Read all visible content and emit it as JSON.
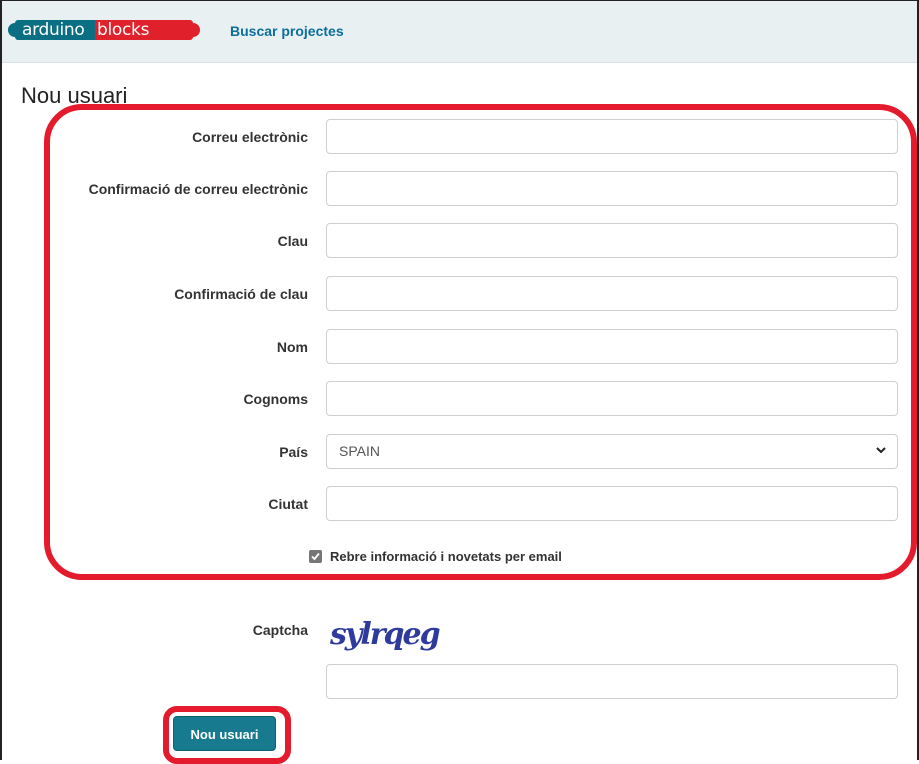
{
  "header": {
    "logo_part1": "arduino",
    "logo_part2": "blocks",
    "nav_link": "Buscar projectes"
  },
  "page_title": "Nou usuari",
  "form": {
    "email_label": "Correu electrònic",
    "email_confirm_label": "Confirmació de correu electrònic",
    "password_label": "Clau",
    "password_confirm_label": "Confirmació de clau",
    "name_label": "Nom",
    "surname_label": "Cognoms",
    "country_label": "País",
    "country_value": "SPAIN",
    "city_label": "Ciutat",
    "newsletter_label": "Rebre informació i novetats per email",
    "newsletter_checked": true,
    "captcha_label": "Captcha",
    "captcha_text": "sylrqeg",
    "submit_label": "Nou usuari"
  },
  "colors": {
    "highlight": "#e41b2c",
    "button": "#177a8e",
    "link": "#0b6f9c",
    "navbar_bg": "#e9f0f2"
  }
}
